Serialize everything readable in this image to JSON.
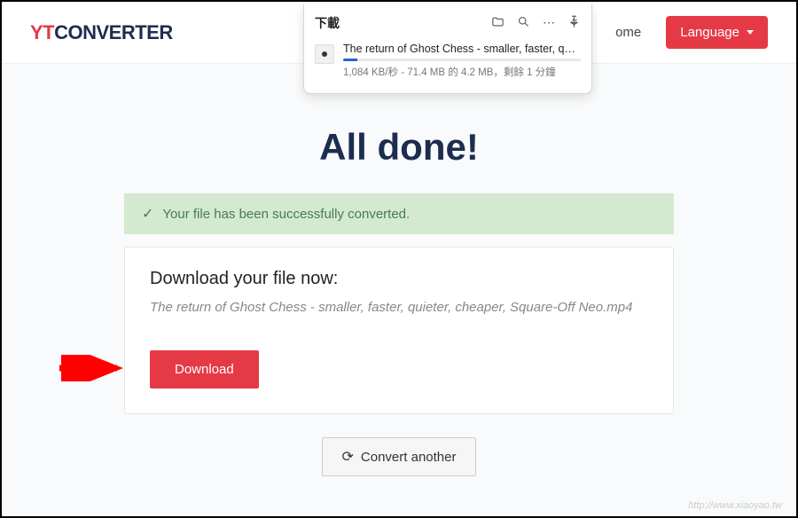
{
  "logo": {
    "prefix": "YT",
    "suffix": "CONVERTER"
  },
  "nav": {
    "home": "ome"
  },
  "language_btn": "Language",
  "title": "All done!",
  "success_msg": "Your file has been successfully converted.",
  "download": {
    "heading": "Download your file now:",
    "filename": "The return of Ghost Chess - smaller, faster, quieter, cheaper, Square-Off Neo.mp4",
    "button": "Download"
  },
  "convert_another": "Convert another",
  "dl_popup": {
    "title": "下載",
    "item_name": "The return of Ghost Chess - smaller, faster, quieter, c…",
    "status": "1,084 KB/秒 - 71.4 MB 的 4.2 MB，剩餘 1 分鐘"
  },
  "watermark_url": "http://www.xiaoyao.tw"
}
